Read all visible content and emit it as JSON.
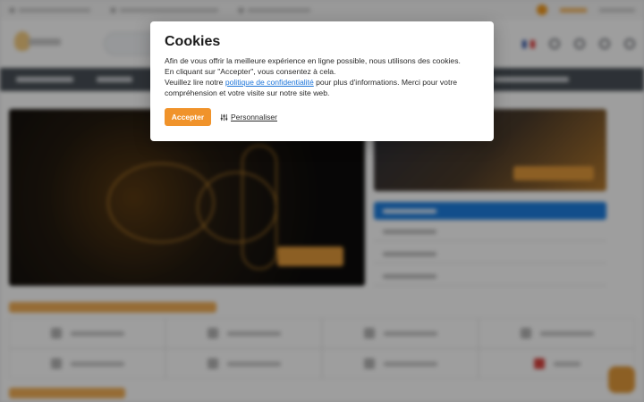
{
  "cookie_modal": {
    "title": "Cookies",
    "line1": "Afin de vous offrir la meilleure expérience en ligne possible, nous utilisons des cookies.",
    "line2": "En cliquant sur \"Accepter\", vous consentez à cela.",
    "line3_before": "Veuillez lire notre ",
    "privacy_link": "politique de confidentialité",
    "line3_after": " pour plus d'informations. Merci pour votre compréhension et votre visite sur notre site web.",
    "accept_label": "Accepter",
    "customize_label": "Personnaliser",
    "customize_icon": "sliders-icon"
  },
  "colors": {
    "accent": "#f0932b",
    "link": "#1a73d9",
    "nav": "#495057",
    "active_item": "#1e7fe0"
  }
}
